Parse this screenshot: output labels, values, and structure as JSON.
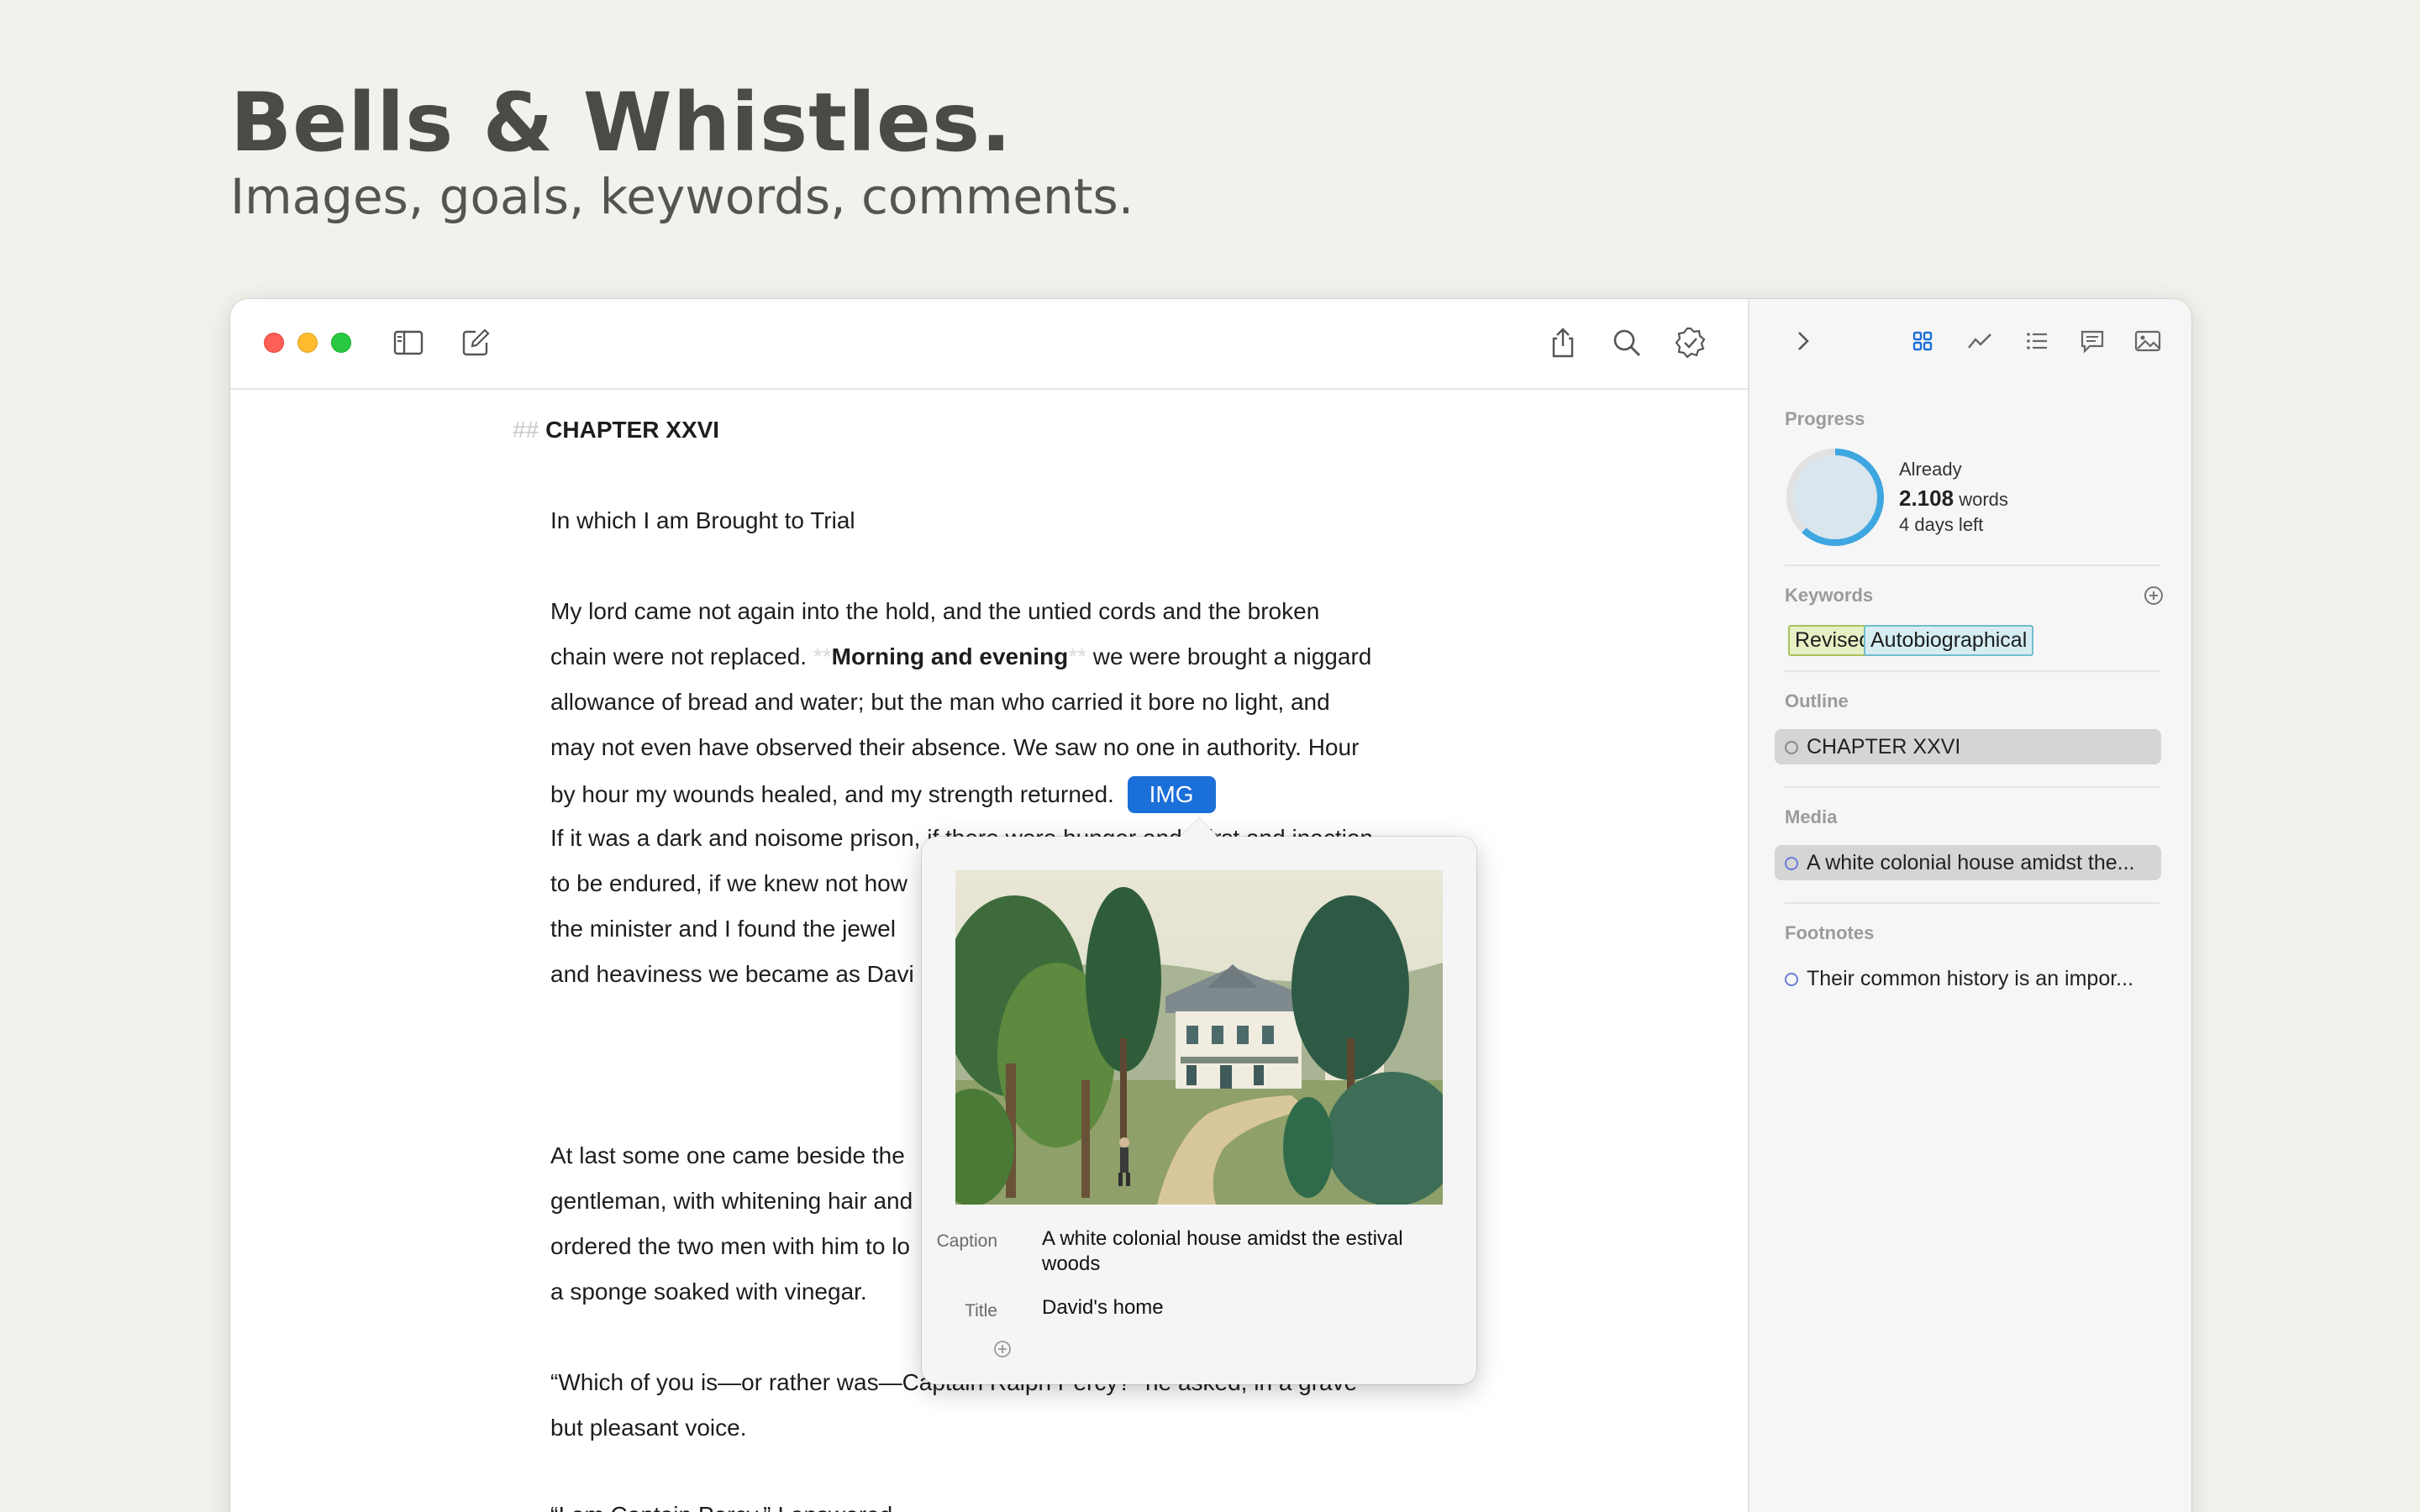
{
  "hero": {
    "title": "Bells & Whistles.",
    "subtitle": "Images, goals, keywords, comments."
  },
  "toolbar": {
    "icons": [
      "sidebar-toggle-icon",
      "compose-icon",
      "share-icon",
      "search-icon",
      "check-badge-icon"
    ]
  },
  "document": {
    "heading_marker": "##",
    "heading": "CHAPTER XXVI",
    "subheading": "In which I am Brought to Trial",
    "p1_line1": "My lord came not again into the hold, and the untied cords and the broken",
    "p1_line2_a": "chain were not replaced. ",
    "p1_line2_mark_open": "**",
    "p1_line2_bold": "Morning and evening",
    "p1_line2_mark_close": "**",
    "p1_line2_b": " we were brought a niggard",
    "p1_line3": "allowance of bread and water; but the man who carried it bore no light, and",
    "p1_line4": "may not even have observed their absence. We saw no one in authority. Hour",
    "p1_line5": "by hour my wounds healed, and my strength returned.",
    "img_tag": "IMG",
    "p2_line1": "If it was a dark and noisome prison, if there were hunger and thirst and inaction",
    "p2_line2": "to be endured, if we knew not how",
    "p2_line3": "the minister and I found the jewel",
    "p2_line4": "and heaviness we became as Davi",
    "p3_line1": "At last some one came beside the",
    "p3_line2": "gentleman, with whitening hair and",
    "p3_line3": "ordered the two men with him to lo",
    "p3_line4": "a sponge soaked with vinegar.",
    "p4_line1_a": "“Which of you is—or rather was—Ca",
    "p4_line1_b": "ptain Ralph Percy?” he asked, in a grave",
    "p4_line2": "but pleasant voice.",
    "p5_line1": "“I am Captain Percy,” I answered."
  },
  "popover": {
    "caption_label": "Caption",
    "caption_value": "A white colonial house amidst the estival woods",
    "title_label": "Title",
    "title_value": "David's home"
  },
  "sidebar": {
    "icons": [
      "chevron-right-icon",
      "grid-icon",
      "stats-icon",
      "list-icon",
      "comment-icon",
      "image-icon"
    ],
    "progress": {
      "title": "Progress",
      "already": "Already",
      "words_num": "2.108",
      "words_label": "words",
      "days_left": "4 days left",
      "fraction": 0.62
    },
    "keywords": {
      "title": "Keywords",
      "items": [
        "Revised",
        "Autobiographical"
      ]
    },
    "outline": {
      "title": "Outline",
      "items": [
        "CHAPTER XXVI"
      ]
    },
    "media": {
      "title": "Media",
      "items": [
        "A white colonial house amidst the..."
      ]
    },
    "footnotes": {
      "title": "Footnotes",
      "items": [
        "Their common history is an impor..."
      ]
    }
  },
  "colors": {
    "accent": "#1b6fd8",
    "progress_ring": "#3ea6e0",
    "keyword_revised": "#e6f0c4",
    "keyword_auto": "#d6eef3"
  }
}
